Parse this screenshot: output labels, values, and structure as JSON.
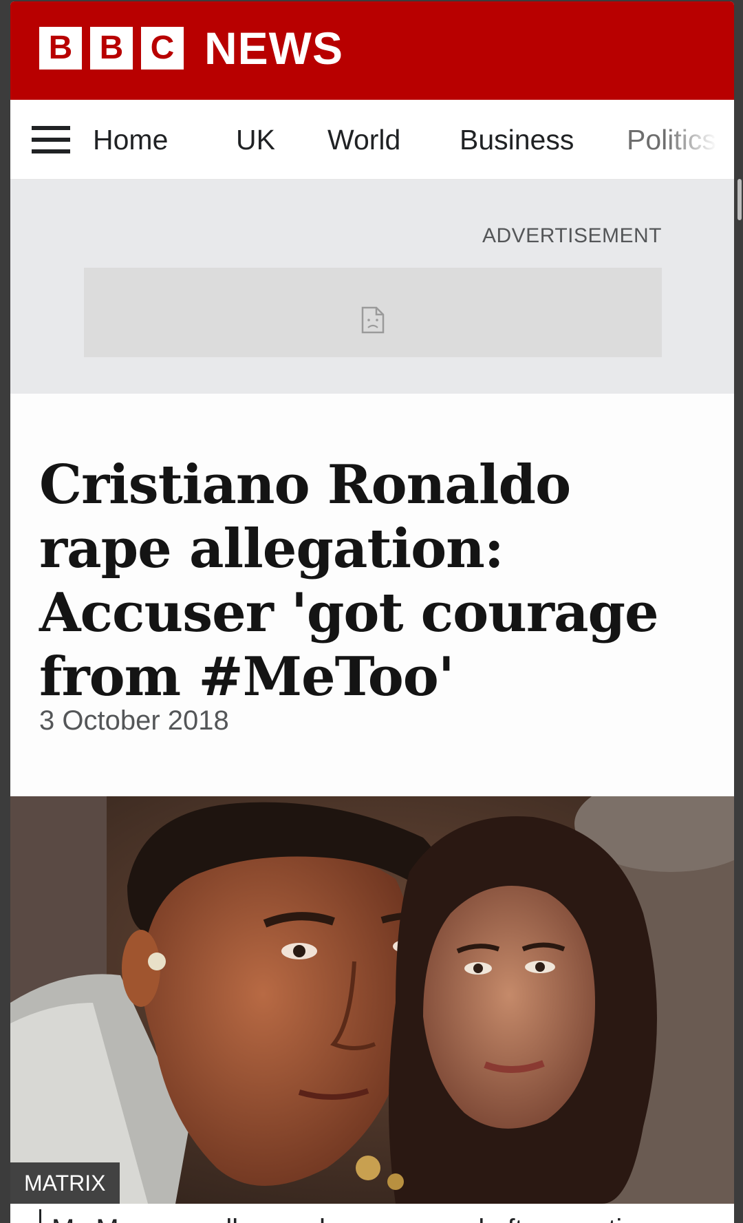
{
  "header": {
    "logo_letters": [
      "B",
      "B",
      "C"
    ],
    "logo_word": "NEWS",
    "background_color": "#b80000"
  },
  "nav": {
    "menu_icon": "hamburger-menu-icon",
    "items": [
      {
        "label": "Home"
      },
      {
        "label": "UK"
      },
      {
        "label": "World"
      },
      {
        "label": "Business"
      },
      {
        "label": "Politics"
      }
    ]
  },
  "advertisement": {
    "label": "ADVERTISEMENT",
    "placeholder_icon": "broken-image-icon"
  },
  "article": {
    "headline": "Cristiano Ronaldo rape allegation: Accuser 'got courage from #MeToo'",
    "date": "3 October 2018",
    "image": {
      "credit": "MATRIX"
    },
    "caption_partial": "Ms Mayorga alleges she was raped after meeting"
  }
}
